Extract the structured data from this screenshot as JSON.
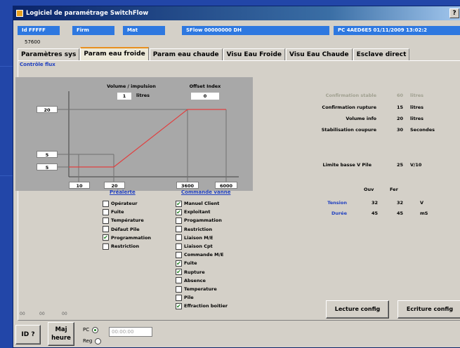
{
  "window": {
    "title": "Logiciel de paramétrage SwitchFlow",
    "help": "?"
  },
  "header": {
    "id": "Id  FFFFF",
    "firm": "Firm",
    "mat": "Mat",
    "sflow": "SFlow   00000000   DH",
    "pc": "PC  4AED6E5      01/11/2009 13:02:2"
  },
  "serial": "57600",
  "tabs": [
    "Paramètres sys",
    "Param eau froide",
    "Param eau chaude",
    "Visu Eau Froide",
    "Visu Eau Chaude",
    "Esclave direct"
  ],
  "section_title": "Contrôle flux",
  "graph": {
    "volume_label": "Volume / impulsion",
    "volume_value": "1",
    "volume_unit": "litres",
    "offset_label": "Offset Index",
    "offset_value": "0",
    "y_ticks": [
      "20",
      "5",
      "5"
    ],
    "x_ticks": [
      "10",
      "20",
      "3600",
      "6000"
    ]
  },
  "params": [
    {
      "label": "Confirmation stable",
      "value": "60",
      "unit": "litres",
      "dim": true
    },
    {
      "label": "Confirmation rupture",
      "value": "15",
      "unit": "litres",
      "dim": false
    },
    {
      "label": "Volume info",
      "value": "20",
      "unit": "litres",
      "dim": false
    },
    {
      "label": "Stabilisation coupure",
      "value": "30",
      "unit": "Secondes",
      "dim": false
    }
  ],
  "limite": {
    "label": "Limite basse V Pile",
    "value": "25",
    "unit": "V/10"
  },
  "vanne": {
    "col_ouv": "Ouv",
    "col_fer": "Fer",
    "rows": [
      {
        "label": "Tension",
        "ouv": "32",
        "fer": "32",
        "unit": "V"
      },
      {
        "label": "Durée",
        "ouv": "45",
        "fer": "45",
        "unit": "mS"
      }
    ]
  },
  "prealerte": {
    "title": "Préalerte",
    "items": [
      {
        "label": "Opérateur",
        "checked": false
      },
      {
        "label": "Fuite",
        "checked": false
      },
      {
        "label": "Température",
        "checked": false
      },
      {
        "label": "Défaut Pile",
        "checked": false
      },
      {
        "label": "Programmation",
        "checked": true
      },
      {
        "label": "Restriction",
        "checked": false
      }
    ]
  },
  "commande": {
    "title": "Commande vanne",
    "items": [
      {
        "label": "Manuel Client",
        "checked": true
      },
      {
        "label": "Exploitant",
        "checked": true
      },
      {
        "label": "Progammation",
        "checked": false
      },
      {
        "label": "Restriction",
        "checked": false
      },
      {
        "label": "Liaison M/E",
        "checked": false
      },
      {
        "label": "Liaison Cpt",
        "checked": false
      },
      {
        "label": "Commande M/E",
        "checked": false
      },
      {
        "label": "Fuite",
        "checked": true
      },
      {
        "label": "Rupture",
        "checked": true
      },
      {
        "label": "Absence",
        "checked": false
      },
      {
        "label": "Temperature",
        "checked": false
      },
      {
        "label": "Pile",
        "checked": false
      },
      {
        "label": "Effraction boitier",
        "checked": true
      }
    ]
  },
  "buttons": {
    "lecture": "Lecture config",
    "ecriture": "Ecriture config",
    "id": "ID ?",
    "maj": "Maj heure"
  },
  "zeros": [
    "00",
    "00",
    "00"
  ],
  "radio": {
    "pc": "PC",
    "reg": "Reg",
    "time": "00:00:00"
  }
}
